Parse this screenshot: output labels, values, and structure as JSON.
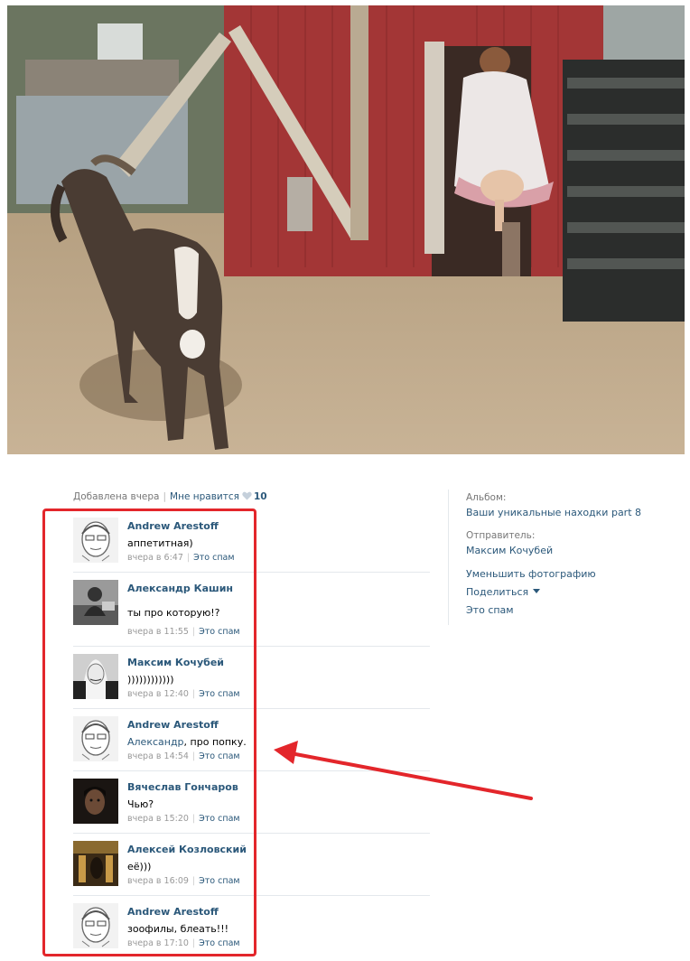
{
  "meta": {
    "added": "Добавлена вчера",
    "likes_label": "Мне нравится",
    "likes_count": "10"
  },
  "comments": [
    {
      "author": "Andrew Arestoff",
      "text": "аппетитная)",
      "time": "вчера в 6:47",
      "spam": "Это спам"
    },
    {
      "author": "Александр Кашин",
      "text": "ты про которую!?",
      "time": "вчера в 11:55",
      "spam": "Это спам"
    },
    {
      "author": "Максим Кочубей",
      "text": "))))))))))))",
      "time": "вчера в 12:40",
      "spam": "Это спам"
    },
    {
      "author": "Andrew Arestoff",
      "mention": "Александр",
      "text": ", про попку.",
      "time": "вчера в 14:54",
      "spam": "Это спам"
    },
    {
      "author": "Вячеслав Гончаров",
      "text": "Чью?",
      "time": "вчера в 15:20",
      "spam": "Это спам"
    },
    {
      "author": "Алексей Козловский",
      "text": "её)))",
      "time": "вчера в 16:09",
      "spam": "Это спам"
    },
    {
      "author": "Andrew Arestoff",
      "text": "зоофилы, блеать!!!",
      "time": "вчера в 17:10",
      "spam": "Это спам"
    }
  ],
  "sidebar": {
    "album_label": "Альбом:",
    "album_name": "Ваши уникальные находки part 8",
    "sender_label": "Отправитель:",
    "sender_name": "Максим Кочубей",
    "shrink": "Уменьшить фотографию",
    "share": "Поделиться",
    "spam": "Это спам"
  },
  "colors": {
    "link": "#2b587a",
    "annotation": "#e3262b",
    "barn": "#9b3232"
  },
  "icons": [
    "heart-icon",
    "dropdown-caret-icon"
  ]
}
